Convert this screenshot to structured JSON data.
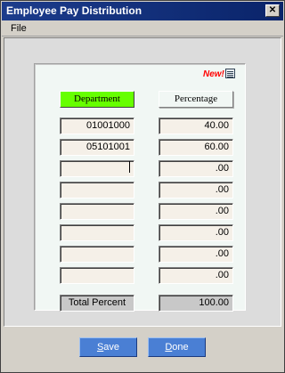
{
  "window": {
    "title": "Employee Pay Distribution",
    "close_glyph": "✕"
  },
  "menu": {
    "items": [
      "File"
    ]
  },
  "badge": {
    "text": "New!",
    "icon": "document-list-icon",
    "color": "#ff0000"
  },
  "table": {
    "headers": {
      "department": "Department",
      "percentage": "Percentage"
    },
    "header_dept_color": "#66ff00",
    "rows": [
      {
        "department": "01001000",
        "percentage": "40.00"
      },
      {
        "department": "05101001",
        "percentage": "60.00"
      },
      {
        "department": "",
        "percentage": ".00"
      },
      {
        "department": "",
        "percentage": ".00"
      },
      {
        "department": "",
        "percentage": ".00"
      },
      {
        "department": "",
        "percentage": ".00"
      },
      {
        "department": "",
        "percentage": ".00"
      },
      {
        "department": "",
        "percentage": ".00"
      }
    ],
    "total_label": "Total Percent",
    "total_value": "100.00"
  },
  "buttons": {
    "save": {
      "mnemonic": "S",
      "rest": "ave"
    },
    "done": {
      "mnemonic": "D",
      "rest": "one"
    }
  },
  "colors": {
    "title_bar": "#0a246a",
    "button": "#4a7fd4",
    "panel": "#f1f7f4"
  }
}
